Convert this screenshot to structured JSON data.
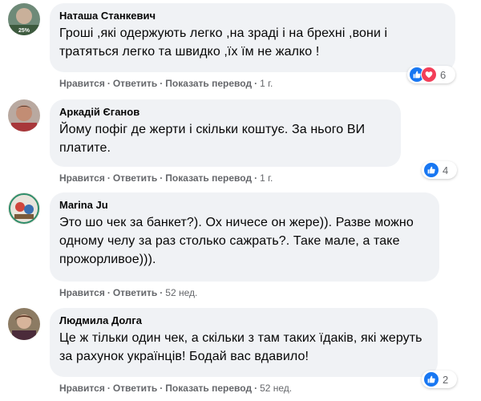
{
  "comments": [
    {
      "author": "Наташа Станкевич",
      "avatar_badge": "25%",
      "text": "Гроші ,які одержують легко ,на зраді і на брехні ,вони і тратяться легко та швидко ,їх їм не жалко !",
      "actions": {
        "like": "Нравится",
        "reply": "Ответить",
        "translate": "Показать перевод",
        "time": "1 г."
      },
      "reactions": {
        "icons": [
          "like-icon",
          "heart-icon"
        ],
        "count": "6"
      }
    },
    {
      "author": "Аркадій Єганов",
      "text": "Йому пофіг де жерти і скільки коштує. За нього ВИ платите.",
      "actions": {
        "like": "Нравится",
        "reply": "Ответить",
        "translate": "Показать перевод",
        "time": "1 г."
      },
      "reactions": {
        "icons": [
          "like-icon"
        ],
        "count": "4"
      }
    },
    {
      "author": "Marina Ju",
      "text": "Это шо чек за банкет?). Ох ничесе он жере)). Разве можно одному челу за раз столько сажрать?. Таке мале, а таке прожорливое))).",
      "actions": {
        "like": "Нравится",
        "reply": "Ответить",
        "time": "52 нед."
      }
    },
    {
      "author": "Людмила Долга",
      "text": "Це ж тільки один чек, а скільки з там таких їдаків, які жеруть за рахунок українців! Бодай вас вдавило!",
      "actions": {
        "like": "Нравится",
        "reply": "Ответить",
        "translate": "Показать перевод",
        "time": "52 нед."
      },
      "reactions": {
        "icons": [
          "like-icon"
        ],
        "count": "2"
      }
    }
  ],
  "colors": {
    "bubble": "#f0f2f5",
    "meta_text": "#65676b",
    "like_blue": "#1877f2",
    "love_red": "#f33e58"
  }
}
